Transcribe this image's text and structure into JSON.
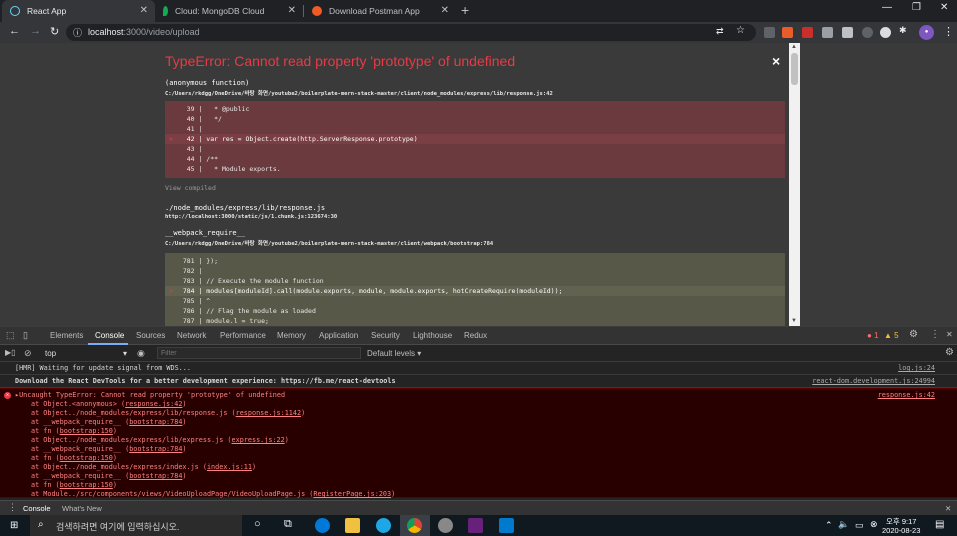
{
  "browser": {
    "tabs": [
      {
        "label": "React App",
        "active": true
      },
      {
        "label": "Cloud: MongoDB Cloud",
        "active": false
      },
      {
        "label": "Download Postman App",
        "active": false
      }
    ],
    "url_host": "localhost",
    "url_path": ":3000/video/upload"
  },
  "overlay": {
    "title": "TypeError: Cannot read property 'prototype' of undefined",
    "close": "×",
    "frame1": {
      "fn": "(anonymous function)",
      "loc": "C:/Users/rkdgg/OneDrive/바탕 화면/youtube2/boilerplate-mern-stack-master/client/node_modules/express/lib/response.js:42",
      "lines": [
        "   39 |   * @public",
        "   40 |   */",
        "   41 |",
        "   42 | var res = Object.create(http.ServerResponse.prototype)",
        "   43 |",
        "   44 | /**",
        "   45 |   * Module exports."
      ]
    },
    "view_compiled": "View compiled",
    "frame2": {
      "fn": "./node_modules/express/lib/response.js",
      "loc": "http://localhost:3000/static/js/1.chunk.js:123674:30"
    },
    "frame3": {
      "fn": "__webpack_require__",
      "loc": "C:/Users/rkdgg/OneDrive/바탕 화면/youtube2/boilerplate-mern-stack-master/client/webpack/bootstrap:784",
      "lines": [
        "  781 | });",
        "  782 |",
        "  783 | // Execute the module function",
        "  784 | modules[moduleId].call(module.exports, module, module.exports, hotCreateRequire(moduleId));",
        "  785 | ^",
        "  786 | // Flag the module as loaded",
        "  787 | module.l = true;"
      ]
    }
  },
  "devtools": {
    "tabs": [
      "Elements",
      "Console",
      "Sources",
      "Network",
      "Performance",
      "Memory",
      "Application",
      "Security",
      "Lighthouse",
      "Redux"
    ],
    "error_count": "1",
    "warn_count": "5",
    "context": "top",
    "filter_placeholder": "Filter",
    "levels": "Default levels ▾",
    "messages": [
      {
        "text": "[HMR] Waiting for update signal from WDS...",
        "src": "log.js:24"
      },
      {
        "text": "Download the React DevTools for a better development experience: https://fb.me/react-devtools",
        "src": "react-dom.development.js:24994"
      }
    ],
    "error": {
      "header": "▸Uncaught TypeError: Cannot read property 'prototype' of undefined",
      "src": "response.js:42",
      "stack": [
        {
          "pre": "at Object.<anonymous> (",
          "link": "response.js:42",
          "post": ")"
        },
        {
          "pre": "at Object../node_modules/express/lib/response.js (",
          "link": "response.js:1142",
          "post": ")"
        },
        {
          "pre": "at __webpack_require__ (",
          "link": "bootstrap:784",
          "post": ")"
        },
        {
          "pre": "at fn (",
          "link": "bootstrap:150",
          "post": ")"
        },
        {
          "pre": "at Object../node_modules/express/lib/express.js (",
          "link": "express.js:22",
          "post": ")"
        },
        {
          "pre": "at __webpack_require__ (",
          "link": "bootstrap:784",
          "post": ")"
        },
        {
          "pre": "at fn (",
          "link": "bootstrap:150",
          "post": ")"
        },
        {
          "pre": "at Object../node_modules/express/index.js (",
          "link": "index.js:11",
          "post": ")"
        },
        {
          "pre": "at __webpack_require__ (",
          "link": "bootstrap:784",
          "post": ")"
        },
        {
          "pre": "at fn (",
          "link": "bootstrap:150",
          "post": ")"
        },
        {
          "pre": "at Module../src/components/views/VideoUploadPage/VideoUploadPage.js (",
          "link": "RegisterPage.js:203",
          "post": ")"
        }
      ]
    },
    "drawer_tabs": [
      "Console",
      "What's New"
    ]
  },
  "taskbar": {
    "search_placeholder": "검색하려면 여기에 입력하십시오.",
    "time": "오후 9:17",
    "date": "2020-08-23"
  }
}
